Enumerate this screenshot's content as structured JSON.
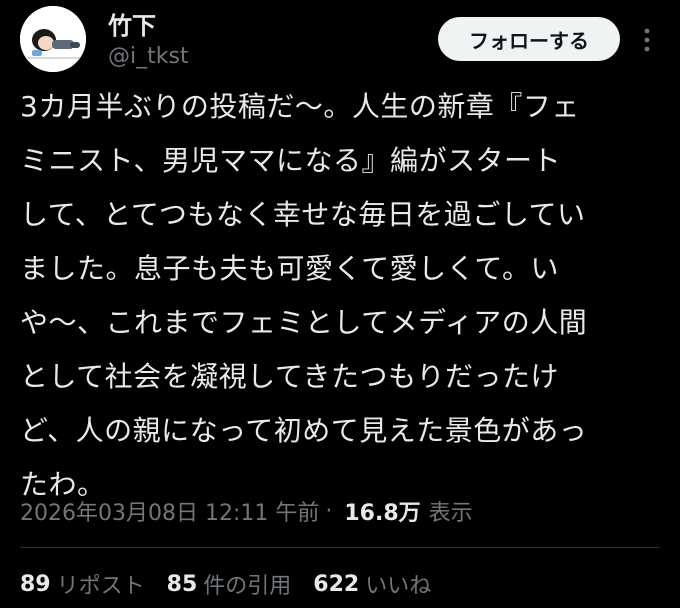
{
  "author": {
    "display_name": "竹下",
    "handle": "@i_tkst",
    "avatar_icon": "avatar-illustration-icon"
  },
  "header": {
    "follow_label": "フォローする",
    "more_icon": "more-vertical-icon"
  },
  "tweet": {
    "lines": [
      "3カ月半ぶりの投稿だ〜。人生の新章『フェ",
      "ミニスト、男児ママになる』編がスタート",
      "して、とてつもなく幸せな毎日を過ごしてい",
      "ました。息子も夫も可愛くて愛しくて。い",
      "や〜、これまでフェミとしてメディアの人間",
      "として社会を凝視してきたつもりだったけ",
      "ど、人の親になって初めて見えた景色があっ",
      "たわ。"
    ]
  },
  "meta": {
    "timestamp": "2026年03月08日 12:11 午前",
    "separator": "·",
    "views_count": "16.8万",
    "views_label": "表示"
  },
  "stats": {
    "reposts_count": "89",
    "reposts_label": "リポスト",
    "quotes_count": "85",
    "quotes_label": "件の引用",
    "likes_count": "622",
    "likes_label": "いいね"
  },
  "colors": {
    "background": "#000000",
    "primary_text": "#e7e9ea",
    "secondary_text": "#71767b",
    "button_bg": "#eff3f4",
    "divider": "#2f3336"
  }
}
